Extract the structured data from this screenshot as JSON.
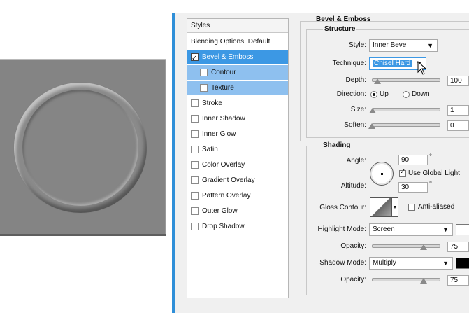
{
  "colors": {
    "selected_row": "#3c98e4",
    "sub_row": "#8ec0ef",
    "highlight_color": "#ffffff",
    "shadow_color": "#000000"
  },
  "styles_panel": {
    "title": "Styles",
    "items": [
      {
        "label": "Blending Options: Default",
        "checkbox": false,
        "checked": false,
        "state": "normal"
      },
      {
        "label": "Bevel & Emboss",
        "checkbox": true,
        "checked": true,
        "state": "selected"
      },
      {
        "label": "Contour",
        "checkbox": true,
        "checked": false,
        "state": "sub"
      },
      {
        "label": "Texture",
        "checkbox": true,
        "checked": false,
        "state": "sub"
      },
      {
        "label": "Stroke",
        "checkbox": true,
        "checked": false,
        "state": "normal"
      },
      {
        "label": "Inner Shadow",
        "checkbox": true,
        "checked": false,
        "state": "normal"
      },
      {
        "label": "Inner Glow",
        "checkbox": true,
        "checked": false,
        "state": "normal"
      },
      {
        "label": "Satin",
        "checkbox": true,
        "checked": false,
        "state": "normal"
      },
      {
        "label": "Color Overlay",
        "checkbox": true,
        "checked": false,
        "state": "normal"
      },
      {
        "label": "Gradient Overlay",
        "checkbox": true,
        "checked": false,
        "state": "normal"
      },
      {
        "label": "Pattern Overlay",
        "checkbox": true,
        "checked": false,
        "state": "normal"
      },
      {
        "label": "Outer Glow",
        "checkbox": true,
        "checked": false,
        "state": "normal"
      },
      {
        "label": "Drop Shadow",
        "checkbox": true,
        "checked": false,
        "state": "normal"
      }
    ]
  },
  "bevel": {
    "title": "Bevel & Emboss",
    "structure": {
      "title": "Structure",
      "style_label": "Style:",
      "style_value": "Inner Bevel",
      "technique_label": "Technique:",
      "technique_value": "Chisel Hard",
      "depth_label": "Depth:",
      "depth_value": "100",
      "depth_level": 0.08,
      "direction_label": "Direction:",
      "direction_up": "Up",
      "direction_down": "Down",
      "direction_selected": "Up",
      "size_label": "Size:",
      "size_value": "1",
      "size_level": 0.01,
      "soften_label": "Soften:",
      "soften_value": "0",
      "soften_level": 0.0
    },
    "shading": {
      "title": "Shading",
      "angle_label": "Angle:",
      "angle_value": "90",
      "angle_unit": "°",
      "use_global_light_label": "Use Global Light",
      "use_global_light": true,
      "altitude_label": "Altitude:",
      "altitude_value": "30",
      "altitude_unit": "°",
      "gloss_contour_label": "Gloss Contour:",
      "anti_aliased_label": "Anti-aliased",
      "anti_aliased": false,
      "highlight_mode_label": "Highlight Mode:",
      "highlight_mode_value": "Screen",
      "highlight_opacity_label": "Opacity:",
      "highlight_opacity_value": "75",
      "highlight_opacity_level": 0.75,
      "shadow_mode_label": "Shadow Mode:",
      "shadow_mode_value": "Multiply",
      "shadow_opacity_label": "Opacity:",
      "shadow_opacity_value": "75",
      "shadow_opacity_level": 0.75
    }
  }
}
